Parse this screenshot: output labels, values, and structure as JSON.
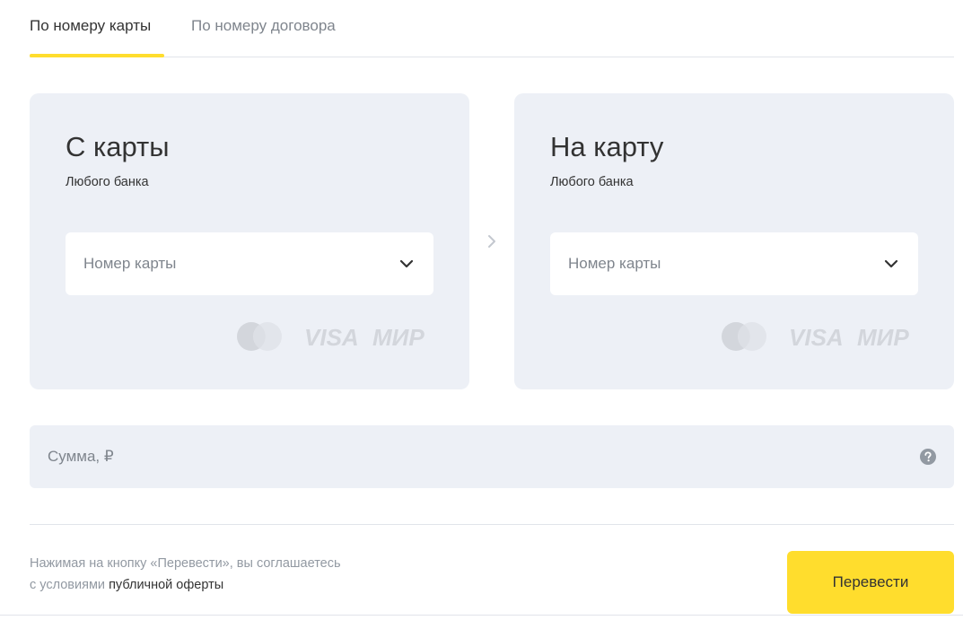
{
  "tabs": [
    {
      "label": "По номеру карты",
      "active": true
    },
    {
      "label": "По номеру договора",
      "active": false
    }
  ],
  "from_card": {
    "title": "С карты",
    "subtitle": "Любого банка",
    "field_placeholder": "Номер карты"
  },
  "to_card": {
    "title": "На карту",
    "subtitle": "Любого банка",
    "field_placeholder": "Номер карты"
  },
  "payment_logos": {
    "icons": [
      "mastercard-icon",
      "visa-icon",
      "mir-icon"
    ],
    "visa_text": "VISA",
    "mir_text": "МИР"
  },
  "amount": {
    "placeholder": "Сумма, ₽",
    "help_icon": "question-circle-icon"
  },
  "footer": {
    "disclaimer_line1": "Нажимая на кнопку «Перевести», вы соглашаетесь",
    "disclaimer_prefix": "с условиями ",
    "offer_link": "публичной оферты",
    "submit_label": "Перевести"
  },
  "colors": {
    "accent": "#ffdd2d",
    "card_bg": "#edf0f6",
    "text": "#333333",
    "muted": "#7f858d"
  }
}
